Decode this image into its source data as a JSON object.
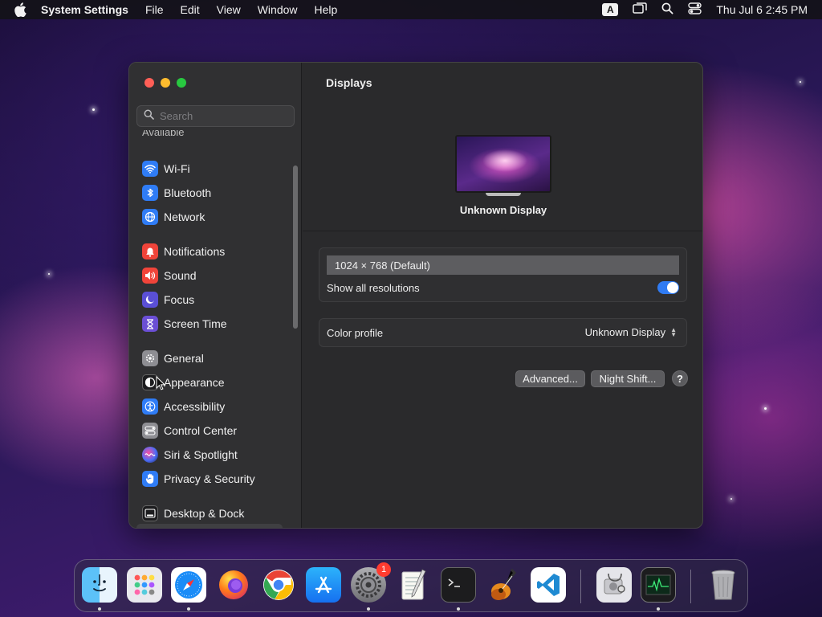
{
  "menubar": {
    "app_name": "System Settings",
    "menus": [
      "File",
      "Edit",
      "View",
      "Window",
      "Help"
    ],
    "input_source": "A",
    "clock": "Thu Jul 6  2:45 PM"
  },
  "sidebar": {
    "search_placeholder": "Search",
    "cut_label": "Available",
    "groups": [
      [
        {
          "label": "Wi-Fi",
          "icon": "wifi-icon",
          "color": "#2f7cf6"
        },
        {
          "label": "Bluetooth",
          "icon": "bluetooth-icon",
          "color": "#2f7cf6"
        },
        {
          "label": "Network",
          "icon": "globe-icon",
          "color": "#2f7cf6"
        }
      ],
      [
        {
          "label": "Notifications",
          "icon": "bell-icon",
          "color": "#f0443a"
        },
        {
          "label": "Sound",
          "icon": "speaker-icon",
          "color": "#f0443a"
        },
        {
          "label": "Focus",
          "icon": "moon-icon",
          "color": "#5a4fd6"
        },
        {
          "label": "Screen Time",
          "icon": "hourglass-icon",
          "color": "#6b4fd6"
        }
      ],
      [
        {
          "label": "General",
          "icon": "gear-icon",
          "color": "#8e8e93"
        },
        {
          "label": "Appearance",
          "icon": "appearance-icon",
          "color": "#1c1c1e"
        },
        {
          "label": "Accessibility",
          "icon": "accessibility-icon",
          "color": "#2f7cf6"
        },
        {
          "label": "Control Center",
          "icon": "toggles-icon",
          "color": "#8e8e93"
        },
        {
          "label": "Siri & Spotlight",
          "icon": "siri-icon",
          "color": "#6a3ad0"
        },
        {
          "label": "Privacy & Security",
          "icon": "hand-icon",
          "color": "#2f7cf6"
        }
      ],
      [
        {
          "label": "Desktop & Dock",
          "icon": "dock-icon",
          "color": "#1c1c1e"
        }
      ]
    ]
  },
  "main": {
    "title": "Displays",
    "display_name": "Unknown Display",
    "resolution": "1024 × 768 (Default)",
    "show_all_label": "Show all resolutions",
    "show_all_on": true,
    "color_profile_label": "Color profile",
    "color_profile_value": "Unknown Display",
    "advanced_button": "Advanced...",
    "night_shift_button": "Night Shift...",
    "help_button": "?"
  },
  "dock": {
    "apps": [
      {
        "name": "finder-icon",
        "running": true
      },
      {
        "name": "launchpad-icon",
        "running": false
      },
      {
        "name": "safari-icon",
        "running": true
      },
      {
        "name": "firefox-icon",
        "running": false
      },
      {
        "name": "chrome-icon",
        "running": false
      },
      {
        "name": "app-store-icon",
        "running": false
      },
      {
        "name": "system-settings-icon",
        "running": true,
        "badge": "1"
      },
      {
        "name": "textedit-icon",
        "running": false
      },
      {
        "name": "terminal-icon",
        "running": true
      },
      {
        "name": "garageband-icon",
        "running": false
      },
      {
        "name": "vscode-icon",
        "running": false
      },
      {
        "name": "disk-utility-icon",
        "running": false
      },
      {
        "name": "activity-monitor-icon",
        "running": true
      },
      {
        "name": "trash-icon",
        "running": false
      }
    ]
  }
}
